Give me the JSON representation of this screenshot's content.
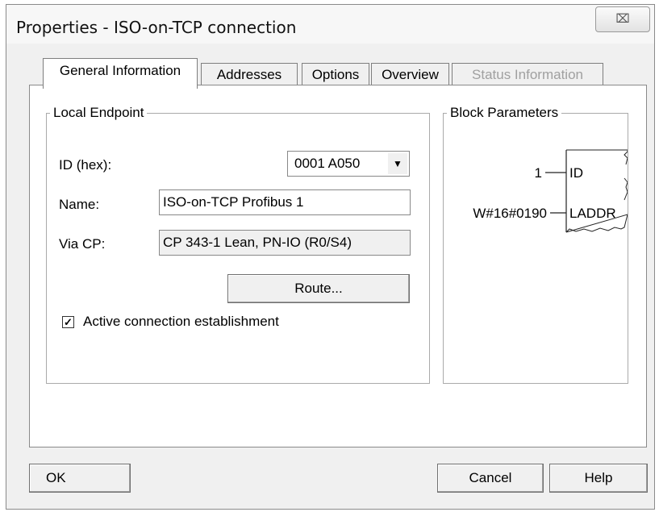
{
  "window": {
    "title": "Properties - ISO-on-TCP connection",
    "close_glyph": "⌧"
  },
  "tabs": [
    {
      "label": "General Information",
      "state": "active"
    },
    {
      "label": "Addresses",
      "state": "normal"
    },
    {
      "label": "Options",
      "state": "normal"
    },
    {
      "label": "Overview",
      "state": "normal"
    },
    {
      "label": "Status Information",
      "state": "disabled"
    }
  ],
  "local_endpoint": {
    "legend": "Local Endpoint",
    "id_label": "ID (hex):",
    "id_value": "0001 A050",
    "name_label": "Name:",
    "name_value": "ISO-on-TCP Profibus 1",
    "via_cp_label": "Via CP:",
    "via_cp_value": "CP 343-1 Lean, PN-IO (R0/S4)",
    "route_button": "Route...",
    "active_connection_label": "Active connection establishment",
    "active_connection_checked": true
  },
  "block_parameters": {
    "legend": "Block Parameters",
    "id_input_value": "1",
    "id_pin": "ID",
    "laddr_input_value": "W#16#0190",
    "laddr_pin": "LADDR"
  },
  "footer": {
    "ok": "OK",
    "cancel": "Cancel",
    "help": "Help"
  }
}
